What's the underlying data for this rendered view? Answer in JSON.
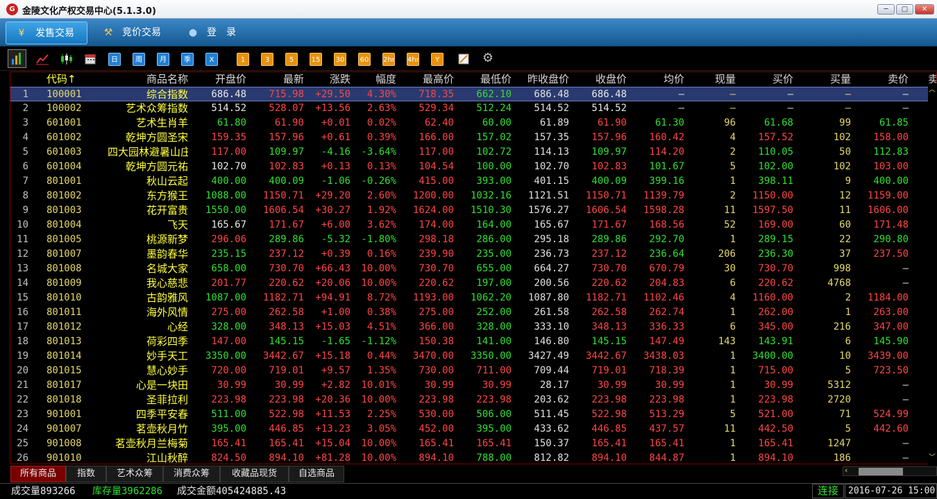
{
  "window": {
    "title": "金陵文化产权交易中心(5.1.3.0)",
    "icon_label": "G",
    "minimize": "─",
    "maximize": "□",
    "close": "✕"
  },
  "menu": [
    {
      "icon": "¥",
      "label": "发售交易",
      "icon_name": "yen-icon"
    },
    {
      "icon": "⚒",
      "label": "竞价交易",
      "icon_name": "auction-hammer-icon"
    },
    {
      "icon": "●",
      "label": "登　录",
      "icon_name": "user-icon"
    }
  ],
  "toolbar": {
    "period_buttons": [
      "日",
      "周",
      "月",
      "季",
      "X"
    ],
    "minute_buttons": [
      "1",
      "3",
      "5",
      "15",
      "30",
      "60",
      "2hr",
      "4hr",
      "Y"
    ]
  },
  "columns": [
    "代码↑",
    "商品名称",
    "开盘价",
    "最新",
    "涨跌",
    "幅度",
    "最高价",
    "最低价",
    "昨收盘价",
    "收盘价",
    "均价",
    "现量",
    "买价",
    "买量",
    "卖价",
    "卖"
  ],
  "rows": [
    [
      "1",
      "100001",
      "综合指数",
      "686.48",
      "715.98",
      "+29.50",
      "4.30%",
      "718.35",
      "662.10",
      "686.48",
      "686.48",
      "—",
      "—",
      "—",
      "—",
      "—"
    ],
    [
      "2",
      "100002",
      "艺术众筹指数",
      "514.52",
      "528.07",
      "+13.56",
      "2.63%",
      "529.34",
      "512.24",
      "514.52",
      "514.52",
      "—",
      "—",
      "—",
      "—",
      "—"
    ],
    [
      "3",
      "601001",
      "艺术生肖羊",
      "61.80",
      "61.90",
      "+0.01",
      "0.02%",
      "62.40",
      "60.00",
      "61.89",
      "61.90",
      "61.30",
      "96",
      "61.68",
      "99",
      "61.85"
    ],
    [
      "4",
      "601002",
      "乾坤方圆圣宋",
      "159.35",
      "157.96",
      "+0.61",
      "0.39%",
      "166.00",
      "157.02",
      "157.35",
      "157.96",
      "160.42",
      "4",
      "157.52",
      "102",
      "158.00"
    ],
    [
      "5",
      "601003",
      "四大园林避暑山庄",
      "117.00",
      "109.97",
      "-4.16",
      "-3.64%",
      "117.00",
      "102.72",
      "114.13",
      "109.97",
      "114.20",
      "2",
      "110.05",
      "50",
      "112.83"
    ],
    [
      "6",
      "601004",
      "乾坤方圆元祐",
      "102.70",
      "102.83",
      "+0.13",
      "0.13%",
      "104.54",
      "100.00",
      "102.70",
      "102.83",
      "101.67",
      "5",
      "102.00",
      "102",
      "103.00"
    ],
    [
      "7",
      "801001",
      "秋山云起",
      "400.00",
      "400.09",
      "-1.06",
      "-0.26%",
      "415.00",
      "393.00",
      "401.15",
      "400.09",
      "399.16",
      "1",
      "398.11",
      "9",
      "400.00"
    ],
    [
      "8",
      "801002",
      "东方猴王",
      "1088.00",
      "1150.71",
      "+29.20",
      "2.60%",
      "1200.00",
      "1032.16",
      "1121.51",
      "1150.71",
      "1139.79",
      "2",
      "1150.00",
      "12",
      "1159.00"
    ],
    [
      "9",
      "801003",
      "花开富贵",
      "1550.00",
      "1606.54",
      "+30.27",
      "1.92%",
      "1624.00",
      "1510.30",
      "1576.27",
      "1606.54",
      "1598.28",
      "11",
      "1597.50",
      "11",
      "1606.00"
    ],
    [
      "10",
      "801004",
      "飞天",
      "165.67",
      "171.67",
      "+6.00",
      "3.62%",
      "174.00",
      "164.00",
      "165.67",
      "171.67",
      "168.56",
      "52",
      "169.00",
      "60",
      "171.48"
    ],
    [
      "11",
      "801005",
      "桃源新梦",
      "296.06",
      "289.86",
      "-5.32",
      "-1.80%",
      "298.18",
      "286.00",
      "295.18",
      "289.86",
      "292.70",
      "1",
      "289.15",
      "22",
      "290.80"
    ],
    [
      "12",
      "801007",
      "墨韵春华",
      "235.15",
      "237.12",
      "+0.39",
      "0.16%",
      "239.90",
      "235.00",
      "236.73",
      "237.12",
      "236.64",
      "206",
      "236.30",
      "37",
      "237.50"
    ],
    [
      "13",
      "801008",
      "名城大家",
      "658.00",
      "730.70",
      "+66.43",
      "10.00%",
      "730.70",
      "655.00",
      "664.27",
      "730.70",
      "670.79",
      "30",
      "730.70",
      "998",
      "—"
    ],
    [
      "14",
      "801009",
      "我心慈悲",
      "201.77",
      "220.62",
      "+20.06",
      "10.00%",
      "220.62",
      "197.00",
      "200.56",
      "220.62",
      "204.83",
      "6",
      "220.62",
      "4768",
      "—"
    ],
    [
      "15",
      "801010",
      "古韵雅风",
      "1087.00",
      "1182.71",
      "+94.91",
      "8.72%",
      "1193.00",
      "1062.20",
      "1087.80",
      "1182.71",
      "1102.46",
      "4",
      "1160.00",
      "2",
      "1184.00"
    ],
    [
      "16",
      "801011",
      "海外风情",
      "275.00",
      "262.58",
      "+1.00",
      "0.38%",
      "275.00",
      "252.00",
      "261.58",
      "262.58",
      "262.74",
      "1",
      "262.00",
      "1",
      "263.00"
    ],
    [
      "17",
      "801012",
      "心经",
      "328.00",
      "348.13",
      "+15.03",
      "4.51%",
      "366.00",
      "328.00",
      "333.10",
      "348.13",
      "336.33",
      "6",
      "345.00",
      "216",
      "347.00"
    ],
    [
      "18",
      "801013",
      "荷彩四季",
      "147.00",
      "145.15",
      "-1.65",
      "-1.12%",
      "150.38",
      "141.00",
      "146.80",
      "145.15",
      "147.49",
      "143",
      "143.91",
      "6",
      "145.90"
    ],
    [
      "19",
      "801014",
      "妙手天工",
      "3350.00",
      "3442.67",
      "+15.18",
      "0.44%",
      "3470.00",
      "3350.00",
      "3427.49",
      "3442.67",
      "3438.03",
      "1",
      "3400.00",
      "10",
      "3439.00"
    ],
    [
      "20",
      "801015",
      "慧心妙手",
      "720.00",
      "719.01",
      "+9.57",
      "1.35%",
      "730.00",
      "711.00",
      "709.44",
      "719.01",
      "718.39",
      "1",
      "715.00",
      "5",
      "723.50"
    ],
    [
      "21",
      "801017",
      "心是一块田",
      "30.99",
      "30.99",
      "+2.82",
      "10.01%",
      "30.99",
      "30.99",
      "28.17",
      "30.99",
      "30.99",
      "1",
      "30.99",
      "5312",
      "—"
    ],
    [
      "22",
      "801018",
      "圣菲拉利",
      "223.98",
      "223.98",
      "+20.36",
      "10.00%",
      "223.98",
      "223.98",
      "203.62",
      "223.98",
      "223.98",
      "1",
      "223.98",
      "2720",
      "—"
    ],
    [
      "23",
      "901001",
      "四季平安春",
      "511.00",
      "522.98",
      "+11.53",
      "2.25%",
      "530.00",
      "506.00",
      "511.45",
      "522.98",
      "513.29",
      "5",
      "521.00",
      "71",
      "524.99"
    ],
    [
      "24",
      "901007",
      "茗壶秋月竹",
      "395.00",
      "446.85",
      "+13.23",
      "3.05%",
      "452.00",
      "395.00",
      "433.62",
      "446.85",
      "437.57",
      "11",
      "442.50",
      "5",
      "442.60"
    ],
    [
      "25",
      "901008",
      "茗壶秋月兰梅菊",
      "165.41",
      "165.41",
      "+15.04",
      "10.00%",
      "165.41",
      "165.41",
      "150.37",
      "165.41",
      "165.41",
      "1",
      "165.41",
      "1247",
      "—"
    ],
    [
      "26",
      "901010",
      "江山秋醉",
      "824.50",
      "894.10",
      "+81.28",
      "10.00%",
      "894.10",
      "788.00",
      "812.82",
      "894.10",
      "844.87",
      "1",
      "894.10",
      "186",
      "—"
    ]
  ],
  "colors": {
    "up": "#ff4545",
    "down": "#30e030",
    "flat": "#e8e8e8",
    "yellow": "#e6d96a"
  },
  "tabs": [
    "所有商品",
    "指数",
    "艺术众筹",
    "消费众筹",
    "收藏品现货",
    "自选商品"
  ],
  "status": {
    "volume_label": "成交量",
    "volume": "893266",
    "stock_label": "库存量",
    "stock": "3962286",
    "amount_label": "成交金额",
    "amount": "405424885.43",
    "connection": "连接",
    "datetime": "2016-07-26 15:00"
  }
}
